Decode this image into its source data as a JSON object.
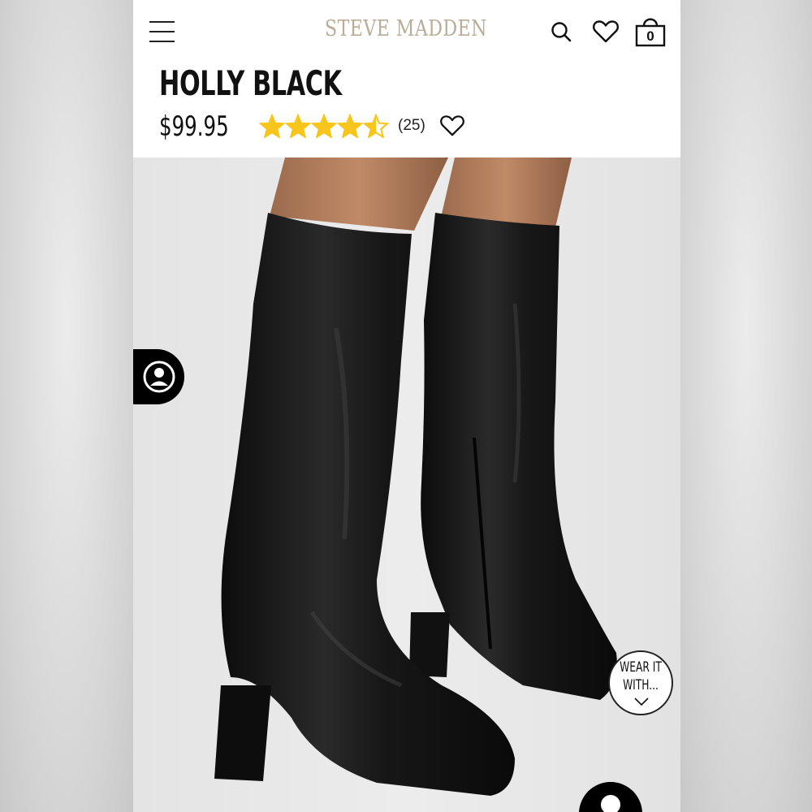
{
  "header": {
    "brand": "STEVE MADDEN",
    "menu_icon": "hamburger-menu-icon",
    "search_icon": "search-icon",
    "wishlist_icon": "heart-icon",
    "bag_icon": "shopping-bag-icon",
    "bag_count": "0"
  },
  "product": {
    "name": "HOLLY BLACK",
    "price": "$99.95",
    "rating": 4.5,
    "rating_max": 5,
    "review_count": "(25)",
    "favorite_icon": "heart-outline-icon"
  },
  "overlays": {
    "accessibility_icon": "user-circle-icon",
    "wear_it_line1": "WEAR IT",
    "wear_it_line2": "WITH...",
    "wear_it_icon": "chevron-down-icon",
    "chat_icon": "chat-icon"
  },
  "colors": {
    "brand_text": "#b9ad97",
    "star": "#f7c51b",
    "text": "#111111",
    "boot": "#141414"
  }
}
